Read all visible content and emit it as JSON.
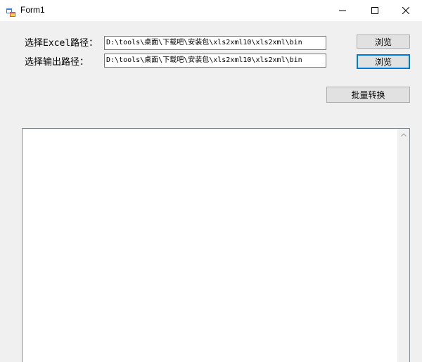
{
  "window": {
    "title": "Form1"
  },
  "form": {
    "excel_label": "选择Excel路径：",
    "output_label": "选择输出路径：",
    "excel_path": "D:\\tools\\桌面\\下载吧\\安装包\\xls2xml10\\xls2xml\\bin",
    "output_path": "D:\\tools\\桌面\\下载吧\\安装包\\xls2xml10\\xls2xml\\bin",
    "browse1_label": "浏览",
    "browse2_label": "浏览",
    "batch_label": "批量转换"
  },
  "log": {
    "content": ""
  },
  "icons": {
    "app": "form-icon",
    "minimize": "minimize-icon",
    "maximize": "maximize-icon",
    "close": "close-icon",
    "scroll_up": "chevron-up-icon"
  }
}
